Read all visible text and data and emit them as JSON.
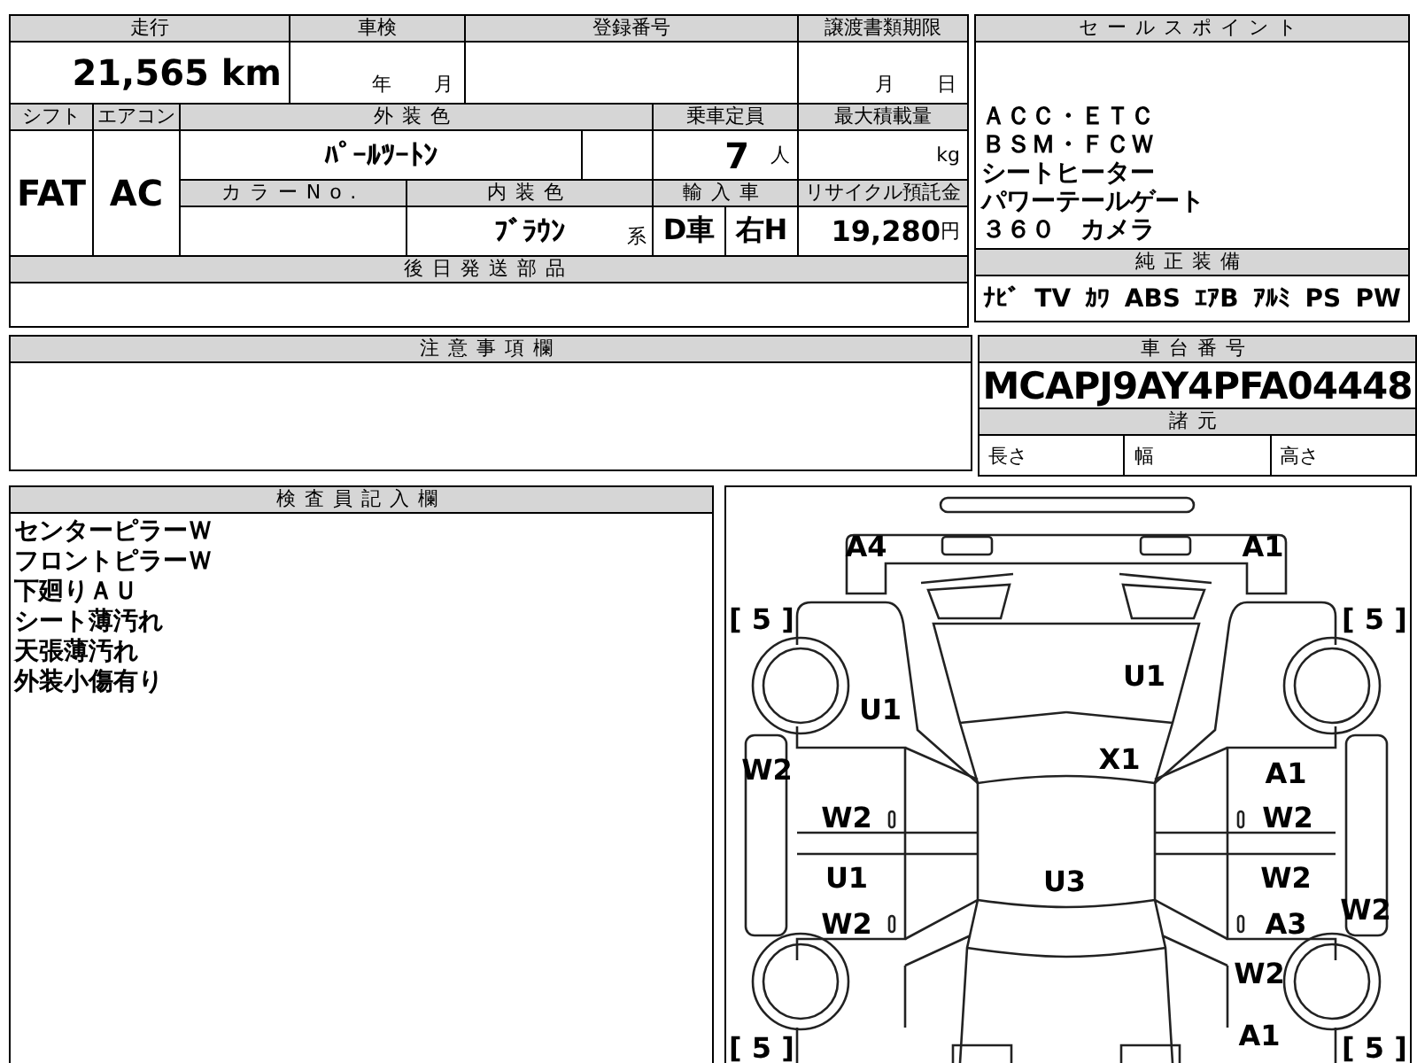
{
  "record_table": {
    "mileage": {
      "label": "走行",
      "value": "21,565",
      "unit": "km"
    },
    "inspection": {
      "label": "車検",
      "year_unit": "年",
      "month_unit": "月"
    },
    "registration": {
      "label": "登録番号"
    },
    "transfer_deadline": {
      "label": "譲渡書類期限",
      "month_unit": "月",
      "day_unit": "日"
    },
    "shift": {
      "label": "シフト",
      "value": "FAT"
    },
    "air_conditioner": {
      "label": "エアコン",
      "value": "AC"
    },
    "exterior_color": {
      "label": "外装色",
      "value": "ﾊﾟｰﾙﾂｰﾄﾝ"
    },
    "capacity": {
      "label": "乗車定員",
      "value": "7",
      "unit": "人"
    },
    "max_load": {
      "label": "最大積載量",
      "unit": "kg"
    },
    "color_no": {
      "label": "カラーNo."
    },
    "interior_color": {
      "label": "内装色",
      "value": "ﾌﾞﾗｳﾝ",
      "suffix": "系"
    },
    "import": {
      "label": "輸入車",
      "dealer": "D車",
      "steering": "右H"
    },
    "recycle_fee": {
      "label": "リサイクル預託金",
      "value": "19,280",
      "unit": "円"
    },
    "later_parts": {
      "label": "後日発送部品"
    }
  },
  "sales_points": {
    "label": "セールスポイント",
    "lines": [
      "ＡＣＣ・ＥＴＣ",
      "ＢＳＭ・ＦＣＷ",
      "シートヒーター",
      "パワーテールゲート",
      "３６０　カメラ"
    ]
  },
  "equipment": {
    "label": "純正装備",
    "items": [
      "ﾅﾋﾞ",
      "TV",
      "ｶﾜ",
      "ABS",
      "ｴｱB",
      "ｱﾙﾐ",
      "PS",
      "PW"
    ]
  },
  "notes": {
    "label": "注意事項欄"
  },
  "chassis": {
    "label": "車台番号",
    "value": "MCAPJ9AY4PFA04448"
  },
  "specs": {
    "label": "諸元",
    "items": [
      "長さ",
      "幅",
      "高さ"
    ]
  },
  "inspector": {
    "label": "検査員記入欄",
    "lines": [
      "センターピラーＷ",
      "フロントピラーＷ",
      "下廻りＡＵ",
      "シート薄汚れ",
      "天張薄汚れ",
      "外装小傷有り"
    ]
  },
  "diagram": {
    "marks": [
      "A4",
      "A1",
      "[ 5 ]",
      "[ 5 ]",
      "U1",
      "U1",
      "W2",
      "X1",
      "A1",
      "W2",
      "W2",
      "U1",
      "U3",
      "W2",
      "W2",
      "W2",
      "A3",
      "W2",
      "[ 5 ]",
      "A1",
      "[ 5 ]"
    ]
  }
}
